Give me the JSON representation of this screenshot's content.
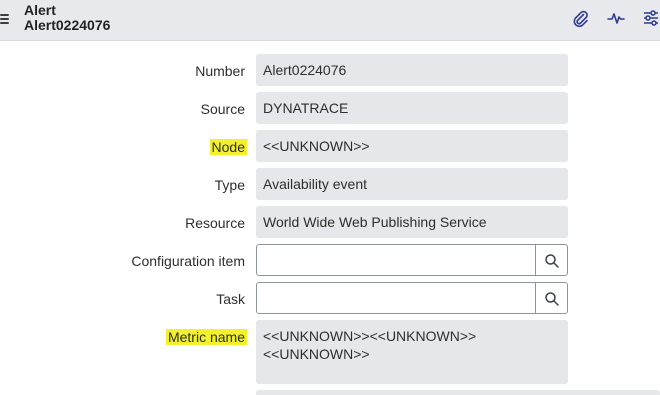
{
  "header": {
    "title": "Alert",
    "record_number": "Alert0224076",
    "icons": [
      "menu-icon",
      "paperclip-icon",
      "activity-icon",
      "settings-sliders-icon"
    ]
  },
  "form": {
    "number": {
      "label": "Number",
      "value": "Alert0224076"
    },
    "source": {
      "label": "Source",
      "value": "DYNATRACE"
    },
    "node": {
      "label": "Node",
      "value": "<<UNKNOWN>>",
      "highlighted": true
    },
    "type": {
      "label": "Type",
      "value": "Availability event"
    },
    "resource": {
      "label": "Resource",
      "value": "World Wide Web Publishing Service"
    },
    "configuration_item": {
      "label": "Configuration item",
      "value": ""
    },
    "task": {
      "label": "Task",
      "value": ""
    },
    "metric_name": {
      "label": "Metric name",
      "value_line1": "<<UNKNOWN>><<UNKNOWN>>",
      "value_line2": "<<UNKNOWN>>",
      "highlighted": true
    }
  },
  "colors": {
    "header_bg": "#e8e9ec",
    "field_bg": "#e6e7ea",
    "highlight": "#f3f12e",
    "icon": "#2f3b8f"
  }
}
